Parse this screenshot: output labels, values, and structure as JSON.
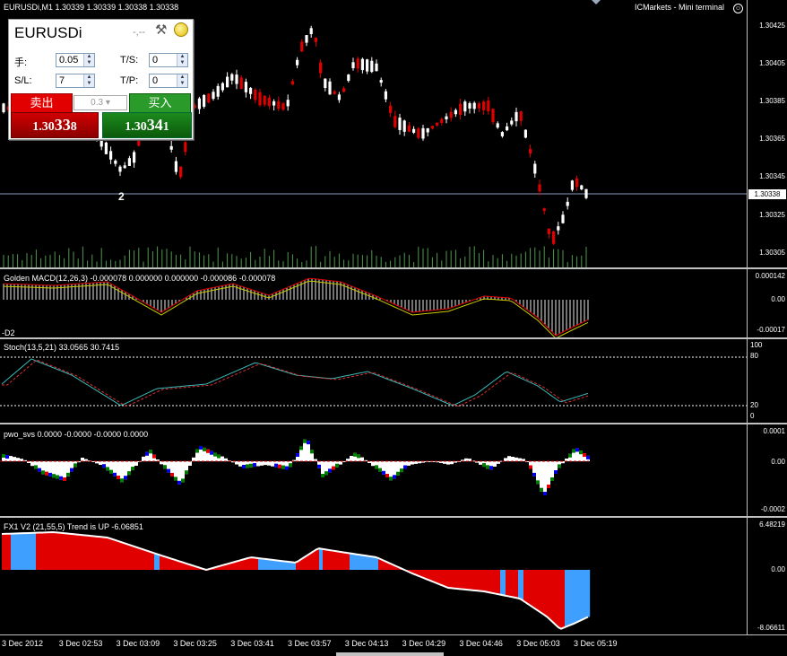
{
  "window": {
    "symbol_info": "EURUSDi,M1  1.30339 1.30339 1.30338 1.30338",
    "terminal": "ICMarkets - Mini terminal",
    "smile_icon": "smile-icon"
  },
  "panel": {
    "symbol": "EURUSDi",
    "dashes": "-,--",
    "lots_label": "手:",
    "lots_value": "0.05",
    "ts_label": "T/S:",
    "ts_value": "0",
    "sl_label": "S/L:",
    "sl_value": "7",
    "tp_label": "T/P:",
    "tp_value": "0",
    "sell_label": "卖出",
    "buy_label": "买入",
    "spread": "0.3",
    "bid_main": "1.30",
    "bid_big": "33",
    "bid_last": "8",
    "ask_main": "1.30",
    "ask_big": "34",
    "ask_last": "1"
  },
  "main_chart": {
    "annotation": "2",
    "current_price": "1.30338",
    "price_labels": [
      "1.30425",
      "1.30405",
      "1.30385",
      "1.30365",
      "1.30345",
      "1.30325",
      "1.30305"
    ]
  },
  "macd": {
    "title": "Golden MACD(12,26,3) -0.000078 0.000000 0.000000 -0.000086 -0.000078",
    "corner": "-D2",
    "scale": [
      "0.000142",
      "0.00",
      "-0.00017"
    ]
  },
  "stoch": {
    "title": "Stoch(13,5,21) 33.0565 30.7415",
    "scale": [
      "100",
      "80",
      "20",
      "0"
    ]
  },
  "pwo": {
    "title": "pwo_svs 0.0000 -0.0000 -0.0000 0.0000",
    "scale": [
      "0.0001",
      "0.00",
      "-0.0002"
    ]
  },
  "trend": {
    "title": "FX1 V2 (21,55,5) Trend is UP -6.06851",
    "scale": [
      "6.48219",
      "0.00",
      "-8.06611"
    ]
  },
  "time_axis": [
    "3 Dec 2012",
    "3 Dec 02:53",
    "3 Dec 03:09",
    "3 Dec 03:25",
    "3 Dec 03:41",
    "3 Dec 03:57",
    "3 Dec 04:13",
    "3 Dec 04:29",
    "3 Dec 04:46",
    "3 Dec 05:03",
    "3 Dec 05:19"
  ]
}
